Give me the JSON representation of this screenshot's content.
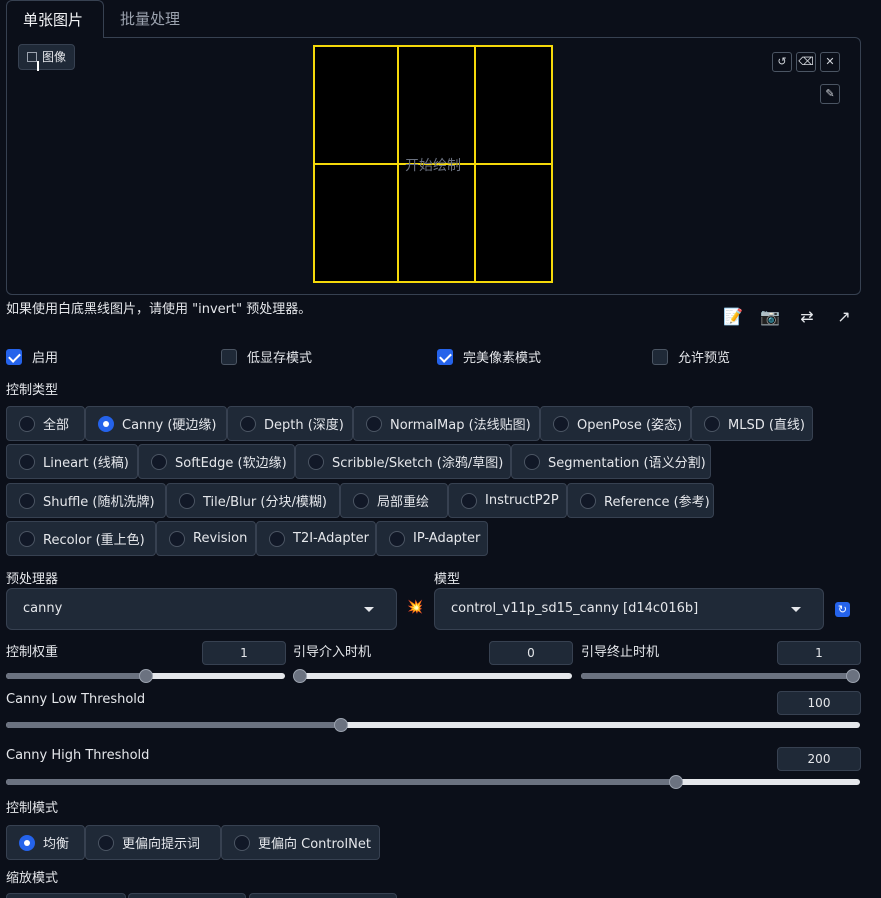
{
  "tabs": [
    {
      "label": "单张图片",
      "active": true
    },
    {
      "label": "批量处理",
      "active": false
    }
  ],
  "image_panel": {
    "badge_label": "图像",
    "canvas_text": "开始绘制"
  },
  "tools": {
    "undo_icon": "undo-icon",
    "eraser_icon": "eraser-icon",
    "close_icon": "close-icon",
    "brush_icon": "brush-icon"
  },
  "hint": "如果使用白底黑线图片，请使用 \"invert\" 预处理器。",
  "actions": [
    "notepad-icon",
    "camera-icon",
    "swap-icon",
    "send-up-icon"
  ],
  "checkboxes": [
    {
      "label": "启用",
      "checked": true
    },
    {
      "label": "低显存模式",
      "checked": false
    },
    {
      "label": "完美像素模式",
      "checked": true
    },
    {
      "label": "允许预览",
      "checked": false
    }
  ],
  "control_type": {
    "label": "控制类型",
    "options": [
      [
        "全部",
        "Canny (硬边缘)",
        "Depth (深度)",
        "NormalMap (法线贴图)",
        "OpenPose (姿态)",
        "MLSD (直线)"
      ],
      [
        "Lineart (线稿)",
        "SoftEdge (软边缘)",
        "Scribble/Sketch (涂鸦/草图)",
        "Segmentation (语义分割)"
      ],
      [
        "Shuffle (随机洗牌)",
        "Tile/Blur (分块/模糊)",
        "局部重绘",
        "InstructP2P",
        "Reference (参考)"
      ],
      [
        "Recolor (重上色)",
        "Revision",
        "T2I-Adapter",
        "IP-Adapter"
      ]
    ],
    "selected": "Canny (硬边缘)"
  },
  "preprocessor": {
    "label": "预处理器",
    "value": "canny"
  },
  "model": {
    "label": "模型",
    "value": "control_v11p_sd15_canny [d14c016b]"
  },
  "sliders_row": [
    {
      "label": "控制权重",
      "value": "1",
      "fraction": 0.5
    },
    {
      "label": "引导介入时机",
      "value": "0",
      "fraction": 0.0
    },
    {
      "label": "引导终止时机",
      "value": "1",
      "fraction": 1.0
    }
  ],
  "canny_low": {
    "label": "Canny Low Threshold",
    "value": "100",
    "fraction": 0.392
  },
  "canny_high": {
    "label": "Canny High Threshold",
    "value": "200",
    "fraction": 0.784
  },
  "control_mode": {
    "label": "控制模式",
    "options": [
      "均衡",
      "更偏向提示词",
      "更偏向 ControlNet"
    ],
    "selected": "均衡"
  },
  "resize_mode": {
    "label": "缩放模式"
  },
  "colors": {
    "accent": "#2563eb",
    "canvas_grid": "#f5d90a"
  }
}
